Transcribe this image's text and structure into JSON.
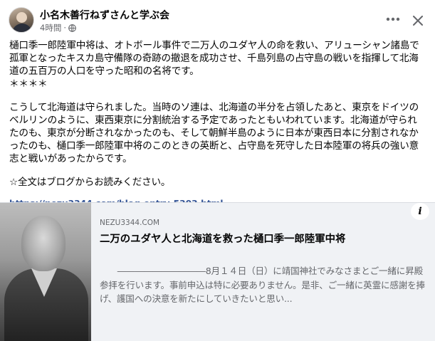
{
  "post": {
    "author_name": "小名木善行ねずさんと学ぶ会",
    "time_label": "4時間",
    "separator": "·",
    "privacy_icon": "globe-icon",
    "more_icon": "more-horizontal-icon",
    "close_icon": "close-icon",
    "paragraphs": [
      "樋口季一郎陸軍中将は、オトボール事件で二万人のユダヤ人の命を救い、アリューシャン諸島で孤軍となったキスカ島守備隊の奇跡の撤退を成功させ、千島列島の占守島の戦いを指揮して北海道の五百万の人口を守った昭和の名将です。",
      "＊＊＊＊",
      "こうして北海道は守られました。当時のソ連は、北海道の半分を占領したあと、東京をドイツのベルリンのように、東西東京に分割統治する予定であったともいわれています。北海道が守られたのも、東京が分断されなかったのも、そして朝鮮半島のように日本が東西日本に分割されなかったのも、樋口季一郎陸軍中将のこのときの英断と、占守島を死守した日本陸軍の将兵の強い意志と戦いがあったからです。",
      "☆全文はブログからお読みください。"
    ],
    "link_text": "https://nezu3344.com/blog-entry-5303.html..."
  },
  "link_card": {
    "domain": "NEZU3344.COM",
    "title": "二万のユダヤ人と北海道を救った樋口季一郎陸軍中将",
    "description": "　　――――――――――8月１４日（日）に靖国神社でみなさまとご一緒に昇殿参拝を行います。事前申込は特に必要ありません。是非、ご一緒に英霊に感謝を捧げ、護国への決意を新たにしていきたいと思い...",
    "info_label": "i"
  }
}
